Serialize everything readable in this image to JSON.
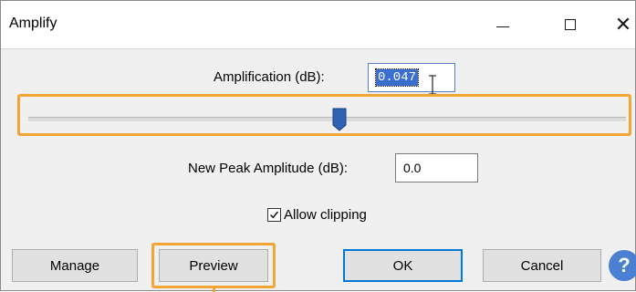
{
  "window": {
    "title": "Amplify"
  },
  "titlebar_buttons": {
    "minimize_icon": "minimize-icon",
    "maximize_icon": "maximize-icon",
    "close_icon": "close-icon",
    "close_glyph": "✕"
  },
  "amplification": {
    "label": "Amplification (dB):",
    "value": "0.047"
  },
  "slider": {
    "value_db": 0.047,
    "position_fraction": 0.52
  },
  "new_peak": {
    "label": "New Peak Amplitude (dB):",
    "value": "0.0"
  },
  "allow_clipping": {
    "label": "Allow clipping",
    "checked": true
  },
  "buttons": {
    "manage": "Manage",
    "preview": "Preview",
    "ok": "OK",
    "cancel": "Cancel",
    "help": "?"
  },
  "colors": {
    "highlight": "#f2a532",
    "selection": "#3a6fd0",
    "default_button_border": "#0078d7",
    "help_button": "#4a7fd1"
  }
}
